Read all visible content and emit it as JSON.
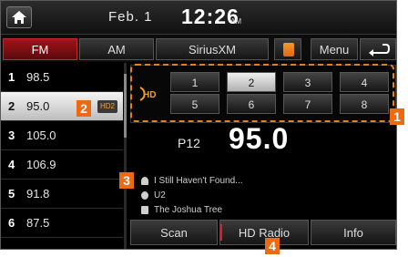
{
  "status_bar": {
    "date": "Feb.  1",
    "time": "12:26",
    "ampm": "AM"
  },
  "tabs": [
    {
      "label": "FM",
      "active": true
    },
    {
      "label": "AM",
      "active": false
    },
    {
      "label": "SiriusXM",
      "active": false
    }
  ],
  "toolbar": {
    "menu_label": "Menu",
    "music_icon": "music-icon",
    "back_icon": "back-arrow-icon",
    "home_icon": "home-icon"
  },
  "stations": [
    {
      "num": "1",
      "freq": "98.5"
    },
    {
      "num": "2",
      "freq": "95.0",
      "selected": true,
      "badge": "HD2"
    },
    {
      "num": "3",
      "freq": "105.0"
    },
    {
      "num": "4",
      "freq": "106.9"
    },
    {
      "num": "5",
      "freq": "91.8"
    },
    {
      "num": "6",
      "freq": "87.5"
    }
  ],
  "presets": [
    "1",
    "2",
    "3",
    "4",
    "5",
    "6",
    "7",
    "8"
  ],
  "active_preset": "2",
  "now_playing": {
    "preset_tag": "P12",
    "frequency": "95.0",
    "song": "I Still Haven't Found...",
    "artist": "U2",
    "album": "The Joshua Tree"
  },
  "bottom": {
    "scan_label": "Scan",
    "hd_label": "HD Radio",
    "info_label": "Info"
  },
  "callouts": [
    "1",
    "2",
    "3",
    "4"
  ],
  "colors": {
    "accent_red": "#a31219",
    "callout_orange": "#ee6a10",
    "hd_orange": "#f59a2a"
  }
}
